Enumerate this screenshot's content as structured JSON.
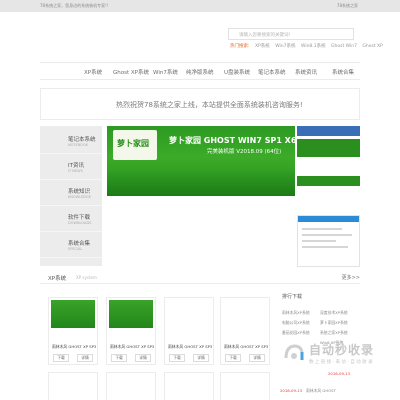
{
  "topbar": {
    "welcome": "78系统之家，您身边的系统装机专家!!",
    "links": "78系统之家"
  },
  "search": {
    "placeholder": "请输入您要搜索的关键词!"
  },
  "hot": {
    "label": "热门搜索:",
    "items": [
      "XP系统",
      "Win7系统",
      "Win8.1系统",
      "Ghost Win7",
      "Ghost XP"
    ]
  },
  "nav": {
    "items": [
      "XP系统",
      "Ghost XP系统",
      "Win7系统",
      "纯净版系统",
      "U盘装系统",
      "笔记本系统",
      "系统资讯",
      "系统合集"
    ]
  },
  "notice": {
    "text": "热烈祝贺78系统之家上线，本站提供全面系统装机咨询服务!"
  },
  "sidebar": {
    "categories": [
      {
        "cn": "笔记本系统",
        "en": "NOTEBOOK"
      },
      {
        "cn": "IT资讯",
        "en": "IT NEWS"
      },
      {
        "cn": "系统知识",
        "en": "KNOWLEDGE"
      },
      {
        "cn": "软件下载",
        "en": "DOWNLOADS"
      },
      {
        "cn": "系统合集",
        "en": "SPECIAL"
      }
    ]
  },
  "banner": {
    "logo_text": "萝卜家园",
    "title": "萝卜家园 GHOST WIN7 SP1 X64",
    "subtitle": "完美装机版 V2018.09 (64位)"
  },
  "section": {
    "title": "XP系统",
    "subtitle": "XP system",
    "more": "更多>>"
  },
  "cards": [
    {
      "name": "雨林木风 GHOST XP SP3 纯净",
      "download": "下载",
      "detail": "详情"
    },
    {
      "name": "雨林木风 GHOST XP SP3 纯",
      "download": "下载",
      "detail": "详情"
    },
    {
      "name": "雨林木风 GHOST XP SP3 纯",
      "download": "下载",
      "detail": "详情"
    },
    {
      "name": "雨林木风 GHOST XP SP3 纯",
      "download": "下载",
      "detail": "详情"
    }
  ],
  "ranking": {
    "title": "排行下载",
    "items": [
      "雨林木风XP系统",
      "深度技术XP系统",
      "电脑公司XP系统",
      "萝卜家园XP系统",
      "番茄花园XP系统",
      "系统之家XP系统",
      "Win8 XP系统"
    ],
    "dates": [
      "2018-09-13",
      "2018-09-13"
    ],
    "bottom_item": "雨林木风 GHOST"
  },
  "watermark": {
    "title": "自动秒收录",
    "subtitle": "数 上 链 接 · 来 访 · 自 动 收 录"
  }
}
